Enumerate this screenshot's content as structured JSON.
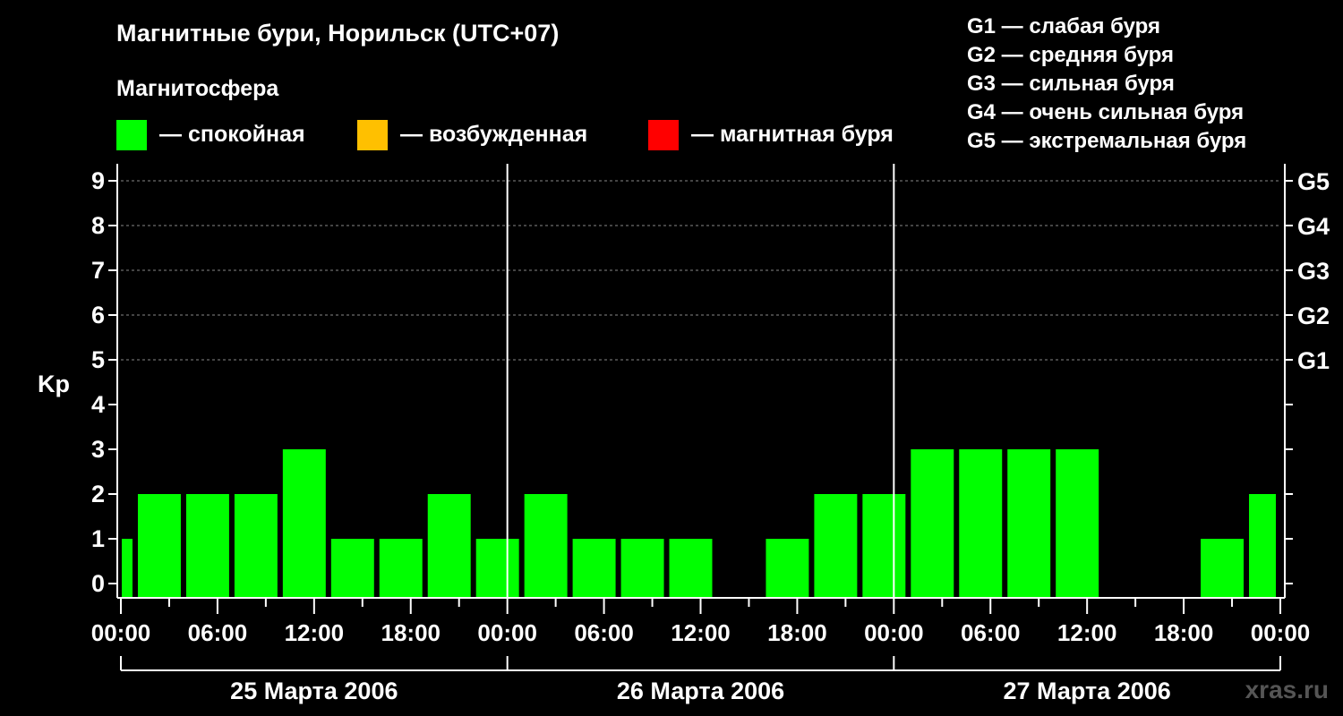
{
  "title": "Магнитные бури, Норильск (UTC+07)",
  "magnetosphere": {
    "title": "Магнитосфера",
    "items": [
      {
        "label": "— спокойная",
        "color": "#00ff00"
      },
      {
        "label": "— возбужденная",
        "color": "#ffc000"
      },
      {
        "label": "— магнитная буря",
        "color": "#ff0000"
      }
    ]
  },
  "g_scale": [
    "G1 — слабая буря",
    "G2 — средняя буря",
    "G3 — сильная буря",
    "G4 — очень сильная буря",
    "G5 — экстремальная буря"
  ],
  "watermark": "xras.ru",
  "chart_data": {
    "type": "bar",
    "ylabel": "Kp",
    "ylim": [
      0,
      9
    ],
    "yticks": [
      0,
      1,
      2,
      3,
      4,
      5,
      6,
      7,
      8,
      9
    ],
    "right_ticks": [
      {
        "value": 5,
        "label": "G1"
      },
      {
        "value": 6,
        "label": "G2"
      },
      {
        "value": 7,
        "label": "G3"
      },
      {
        "value": 8,
        "label": "G4"
      },
      {
        "value": 9,
        "label": "G5"
      }
    ],
    "grid": "dashed horizontal at 5-9",
    "x_range_hours": [
      0,
      72
    ],
    "xtick_labels": [
      "00:00",
      "06:00",
      "12:00",
      "18:00",
      "00:00",
      "06:00",
      "12:00",
      "18:00",
      "00:00",
      "06:00",
      "12:00",
      "18:00",
      "00:00"
    ],
    "days": [
      "25 Марта 2006",
      "26 Марта 2006",
      "27 Марта 2006"
    ],
    "bar_color": "#00ff00",
    "bars": [
      {
        "start_hour": 0,
        "end_hour": 1,
        "kp": 1
      },
      {
        "start_hour": 1,
        "end_hour": 4,
        "kp": 2
      },
      {
        "start_hour": 4,
        "end_hour": 7,
        "kp": 2
      },
      {
        "start_hour": 7,
        "end_hour": 10,
        "kp": 2
      },
      {
        "start_hour": 10,
        "end_hour": 13,
        "kp": 3
      },
      {
        "start_hour": 13,
        "end_hour": 16,
        "kp": 1
      },
      {
        "start_hour": 16,
        "end_hour": 19,
        "kp": 1
      },
      {
        "start_hour": 19,
        "end_hour": 22,
        "kp": 2
      },
      {
        "start_hour": 22,
        "end_hour": 25,
        "kp": 1
      },
      {
        "start_hour": 25,
        "end_hour": 28,
        "kp": 2
      },
      {
        "start_hour": 28,
        "end_hour": 31,
        "kp": 1
      },
      {
        "start_hour": 31,
        "end_hour": 34,
        "kp": 1
      },
      {
        "start_hour": 34,
        "end_hour": 37,
        "kp": 1
      },
      {
        "start_hour": 37,
        "end_hour": 40,
        "kp": 0
      },
      {
        "start_hour": 40,
        "end_hour": 43,
        "kp": 1
      },
      {
        "start_hour": 43,
        "end_hour": 46,
        "kp": 2
      },
      {
        "start_hour": 46,
        "end_hour": 49,
        "kp": 2
      },
      {
        "start_hour": 49,
        "end_hour": 52,
        "kp": 3
      },
      {
        "start_hour": 52,
        "end_hour": 55,
        "kp": 3
      },
      {
        "start_hour": 55,
        "end_hour": 58,
        "kp": 3
      },
      {
        "start_hour": 58,
        "end_hour": 61,
        "kp": 3
      },
      {
        "start_hour": 61,
        "end_hour": 64,
        "kp": 0
      },
      {
        "start_hour": 64,
        "end_hour": 67,
        "kp": 0
      },
      {
        "start_hour": 67,
        "end_hour": 70,
        "kp": 1
      },
      {
        "start_hour": 70,
        "end_hour": 72,
        "kp": 2
      }
    ]
  }
}
